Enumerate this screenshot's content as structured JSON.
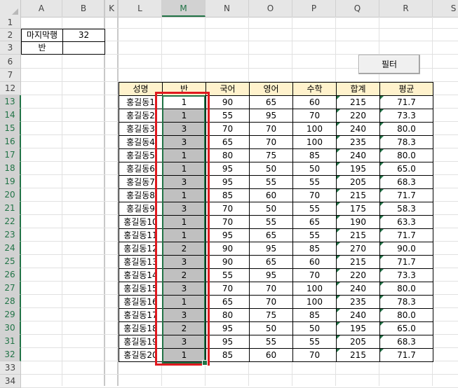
{
  "columns": [
    "A",
    "B",
    "K",
    "L",
    "M",
    "N",
    "O",
    "P",
    "Q",
    "R",
    "S"
  ],
  "selected_column": "M",
  "rows": [
    "1",
    "2",
    "3",
    "6",
    "7",
    "12",
    "13",
    "14",
    "15",
    "16",
    "17",
    "18",
    "19",
    "20",
    "21",
    "22",
    "23",
    "24",
    "25",
    "26",
    "27",
    "28",
    "29",
    "30",
    "31",
    "32",
    "33",
    "34"
  ],
  "info": {
    "last_row_label": "마지막행",
    "last_row_value": "32",
    "class_label": "반",
    "class_value": ""
  },
  "filter_button": "필터",
  "table": {
    "headers": [
      "성명",
      "반",
      "국어",
      "영어",
      "수학",
      "합계",
      "평균"
    ],
    "rows": [
      [
        "홍길동1",
        "1",
        "90",
        "65",
        "60",
        "215",
        "71.7"
      ],
      [
        "홍길동2",
        "1",
        "55",
        "95",
        "70",
        "220",
        "73.3"
      ],
      [
        "홍길동3",
        "3",
        "70",
        "70",
        "100",
        "240",
        "80.0"
      ],
      [
        "홍길동4",
        "3",
        "65",
        "70",
        "100",
        "235",
        "78.3"
      ],
      [
        "홍길동5",
        "1",
        "80",
        "75",
        "85",
        "240",
        "80.0"
      ],
      [
        "홍길동6",
        "1",
        "95",
        "50",
        "50",
        "195",
        "65.0"
      ],
      [
        "홍길동7",
        "3",
        "95",
        "55",
        "55",
        "205",
        "68.3"
      ],
      [
        "홍길동8",
        "1",
        "85",
        "60",
        "70",
        "215",
        "71.7"
      ],
      [
        "홍길동9",
        "3",
        "70",
        "50",
        "55",
        "175",
        "58.3"
      ],
      [
        "홍길동10",
        "1",
        "70",
        "55",
        "65",
        "190",
        "63.3"
      ],
      [
        "홍길동11",
        "1",
        "95",
        "65",
        "55",
        "215",
        "71.7"
      ],
      [
        "홍길동12",
        "2",
        "90",
        "95",
        "85",
        "270",
        "90.0"
      ],
      [
        "홍길동13",
        "3",
        "90",
        "65",
        "60",
        "215",
        "71.7"
      ],
      [
        "홍길동14",
        "2",
        "55",
        "95",
        "70",
        "220",
        "73.3"
      ],
      [
        "홍길동15",
        "3",
        "70",
        "70",
        "100",
        "240",
        "80.0"
      ],
      [
        "홍길동16",
        "1",
        "65",
        "70",
        "100",
        "235",
        "78.3"
      ],
      [
        "홍길동17",
        "3",
        "80",
        "75",
        "85",
        "240",
        "80.0"
      ],
      [
        "홍길동18",
        "2",
        "95",
        "50",
        "50",
        "195",
        "65.0"
      ],
      [
        "홍길동19",
        "3",
        "95",
        "55",
        "55",
        "205",
        "68.3"
      ],
      [
        "홍길동20",
        "1",
        "85",
        "60",
        "70",
        "215",
        "71.7"
      ]
    ]
  },
  "colors": {
    "header_fill": "#fff2cc",
    "selected_fill": "#c0c0c0",
    "selection_border": "#217346",
    "highlight_border": "#e0191f"
  }
}
